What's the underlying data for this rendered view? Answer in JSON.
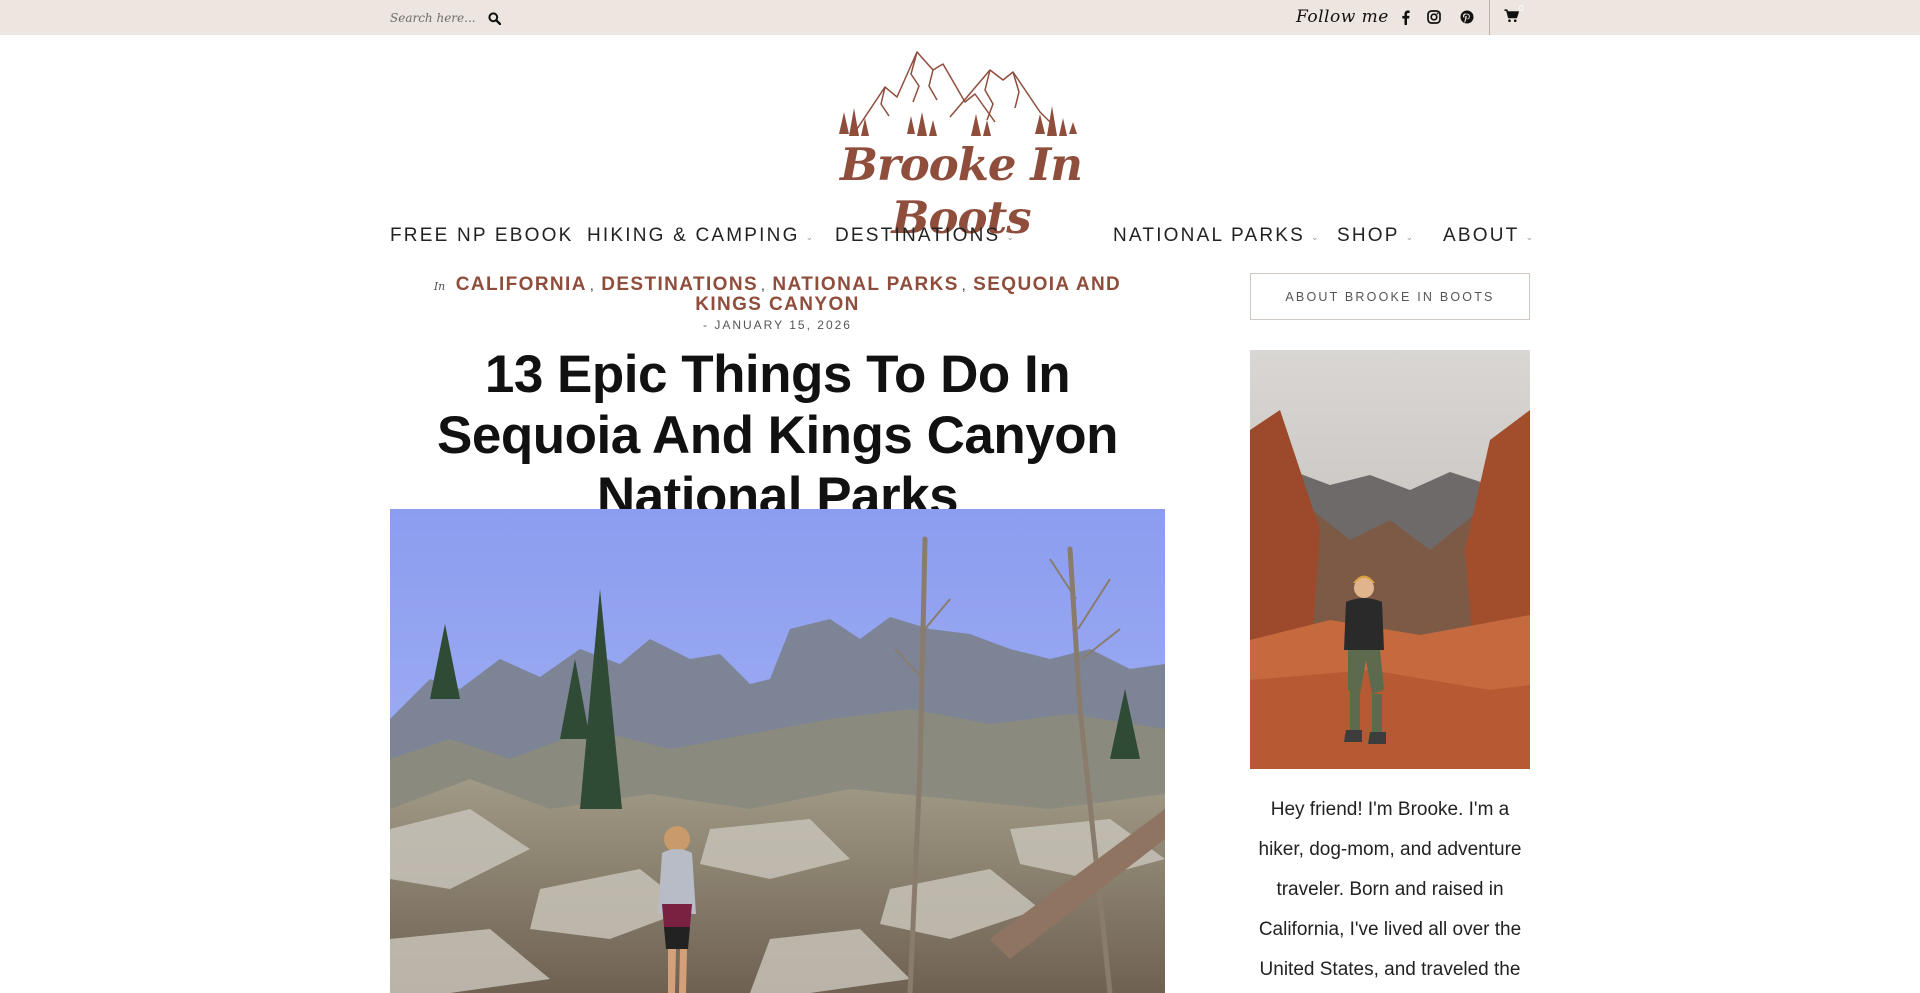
{
  "topbar": {
    "search_placeholder": "Search here...",
    "follow_label": "Follow me",
    "social_icons": [
      "facebook-icon",
      "instagram-icon",
      "pinterest-icon"
    ],
    "cart_count": "0",
    "background": "#ede5df"
  },
  "logo": {
    "text": "Brooke In Boots",
    "color": "#8f4d3c"
  },
  "nav": {
    "items": [
      {
        "label": "FREE NP EBOOK",
        "has_dropdown": false
      },
      {
        "label": "HIKING & CAMPING",
        "has_dropdown": true
      },
      {
        "label": "DESTINATIONS",
        "has_dropdown": true
      },
      {
        "label": "NATIONAL PARKS",
        "has_dropdown": true
      },
      {
        "label": "SHOP",
        "has_dropdown": true
      },
      {
        "label": "ABOUT",
        "has_dropdown": true
      }
    ]
  },
  "post": {
    "in_label": "In",
    "categories": [
      "CALIFORNIA",
      "DESTINATIONS",
      "NATIONAL PARKS",
      "SEQUOIA AND KINGS CANYON"
    ],
    "separator": ",",
    "date": "- JANUARY 15, 2026",
    "title": "13 Epic Things To Do In Sequoia And Kings Canyon National Parks",
    "accent_color": "#8f4d3c"
  },
  "sidebar": {
    "about_button": "ABOUT BROOKE IN BOOTS",
    "bio": "Hey friend! I'm Brooke. I'm a hiker, dog-mom, and adventure traveler. Born and raised in California, I've lived all over the United States, and traveled the"
  }
}
